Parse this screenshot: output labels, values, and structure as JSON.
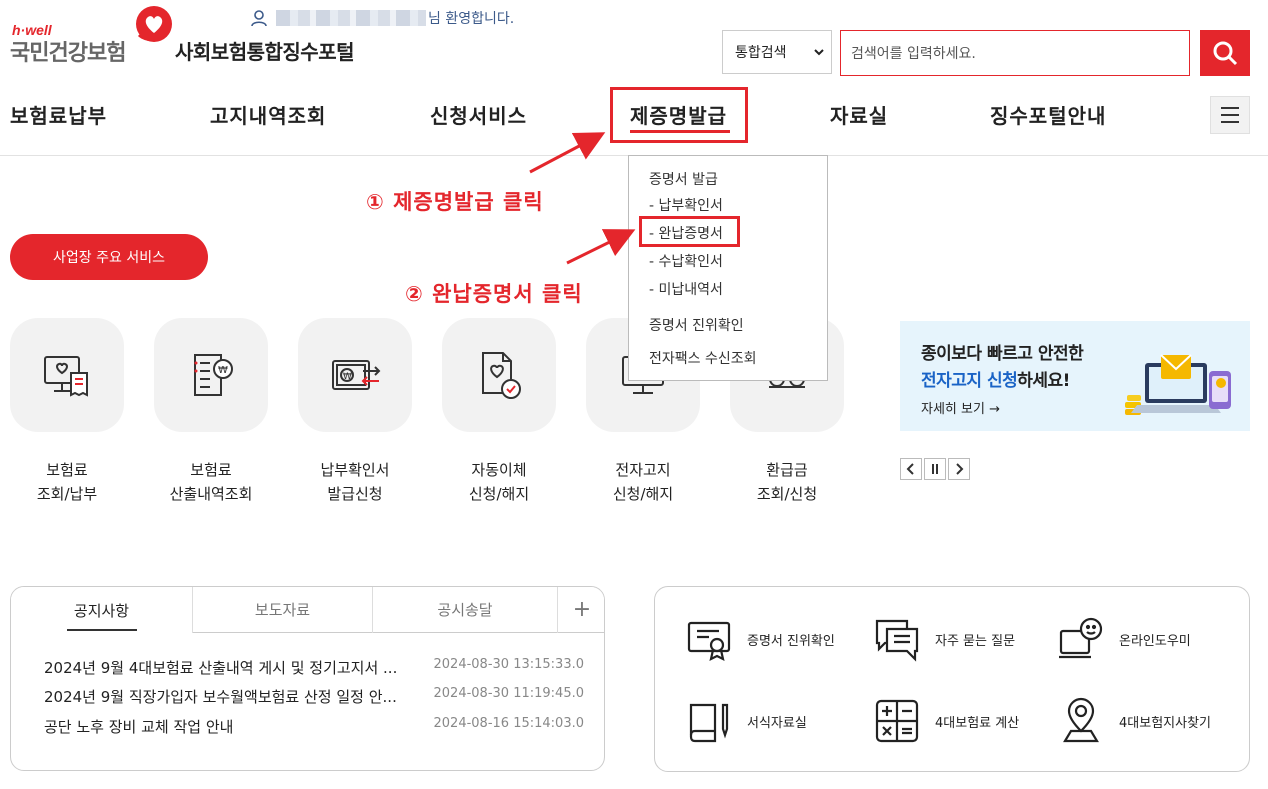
{
  "header": {
    "logo_hwell": "h·well",
    "logo_name": "국민건강보험",
    "portal_title": "사회보험통합징수포털",
    "welcome_suffix": "님 환영합니다.",
    "search_select": "통합검색",
    "search_placeholder": "검색어를 입력하세요."
  },
  "nav": {
    "items": [
      "보험료납부",
      "고지내역조회",
      "신청서비스",
      "제증명발급",
      "자료실",
      "징수포털안내"
    ]
  },
  "dropdown": {
    "group1": "증명서 발급",
    "sub1": "- 납부확인서",
    "sub2": "- 완납증명서",
    "sub3": "- 수납확인서",
    "sub4": "- 미납내역서",
    "group2": "증명서 진위확인",
    "group3": "전자팩스 수신조회"
  },
  "annotations": {
    "step1": "① 제증명발급 클릭",
    "step2": "② 완납증명서 클릭"
  },
  "service_button": "사업장 주요 서비스",
  "tiles": [
    {
      "line1": "보험료",
      "line2": "조회/납부"
    },
    {
      "line1": "보험료",
      "line2": "산출내역조회"
    },
    {
      "line1": "납부확인서",
      "line2": "발급신청"
    },
    {
      "line1": "자동이체",
      "line2": "신청/해지"
    },
    {
      "line1": "전자고지",
      "line2": "신청/해지"
    },
    {
      "line1": "환급금",
      "line2": "조회/신청"
    }
  ],
  "banner": {
    "line1": "종이보다 빠르고 안전한",
    "line2_blue": "전자고지 신청",
    "line2_rest": "하세요!",
    "more": "자세히 보기 →"
  },
  "notice": {
    "tabs": [
      "공지사항",
      "보도자료",
      "공시송달"
    ],
    "plus": "+",
    "rows": [
      {
        "title": "2024년 9월 4대보험료 산출내역 게시 및 정기고지서 ...",
        "date": "2024-08-30 13:15:33.0"
      },
      {
        "title": "2024년 9월 직장가입자 보수월액보험료 산정 일정 안...",
        "date": "2024-08-30 11:19:45.0"
      },
      {
        "title": "공단 노후 장비 교체 작업 안내",
        "date": "2024-08-16 15:14:03.0"
      }
    ]
  },
  "shortcuts": [
    {
      "label": "증명서 진위확인",
      "icon": "certificate-icon"
    },
    {
      "label": "자주 묻는 질문",
      "icon": "faq-icon"
    },
    {
      "label": "온라인도우미",
      "icon": "online-helper-icon"
    },
    {
      "label": "서식자료실",
      "icon": "forms-book-icon"
    },
    {
      "label": "4대보험료 계산",
      "icon": "calculator-icon"
    },
    {
      "label": "4대보험지사찾기",
      "icon": "location-icon"
    }
  ],
  "colors": {
    "accent": "#e4262c",
    "banner_bg": "#e6f4fc",
    "banner_blue": "#1a63c6"
  }
}
